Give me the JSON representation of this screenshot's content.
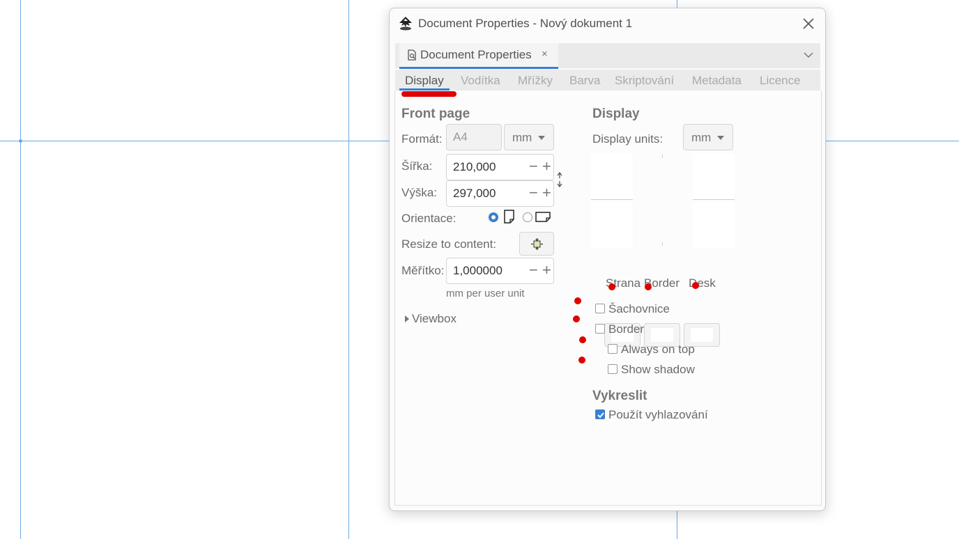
{
  "dialog": {
    "title": "Document Properties - Nový dokument 1"
  },
  "dock": {
    "tab_label": "Document Properties",
    "tab_close": "×"
  },
  "tabs": [
    {
      "label": "Display",
      "active": true
    },
    {
      "label": "Vodítka",
      "active": false
    },
    {
      "label": "Mřížky",
      "active": false
    },
    {
      "label": "Barva",
      "active": false
    },
    {
      "label": "Skriptování",
      "active": false
    },
    {
      "label": "Metadata",
      "active": false
    },
    {
      "label": "Licence",
      "active": false
    }
  ],
  "front_page": {
    "heading": "Front page",
    "format_label": "Formát:",
    "format_value": "A4",
    "format_unit": "mm",
    "width_label": "Šířka:",
    "width_value": "210,000",
    "height_label": "Výška:",
    "height_value": "297,000",
    "orientation_label": "Orientace:",
    "orientation_selected": "portrait",
    "resize_label": "Resize to content:",
    "scale_label": "Měřítko:",
    "scale_value": "1,000000",
    "scale_hint": "mm per user unit",
    "viewbox_label": "Viewbox"
  },
  "display": {
    "heading": "Display",
    "units_label": "Display units:",
    "units_value": "mm",
    "swatches": [
      {
        "label": "Strana"
      },
      {
        "label": "Border"
      },
      {
        "label": "Desk"
      }
    ],
    "checkboxes": [
      {
        "label": "Šachovnice",
        "checked": false
      },
      {
        "label": "Border",
        "checked": false
      },
      {
        "label": "Always on top",
        "checked": false
      },
      {
        "label": "Show shadow",
        "checked": false
      }
    ]
  },
  "render": {
    "heading": "Vykreslit",
    "antialias_label": "Použít vyhlazování",
    "antialias_checked": true
  },
  "spin": {
    "minus": "−",
    "plus": "+"
  },
  "colors": {
    "accent": "#3a7fd0",
    "guide": "#6aa9e6",
    "annotation": "#e00000"
  }
}
